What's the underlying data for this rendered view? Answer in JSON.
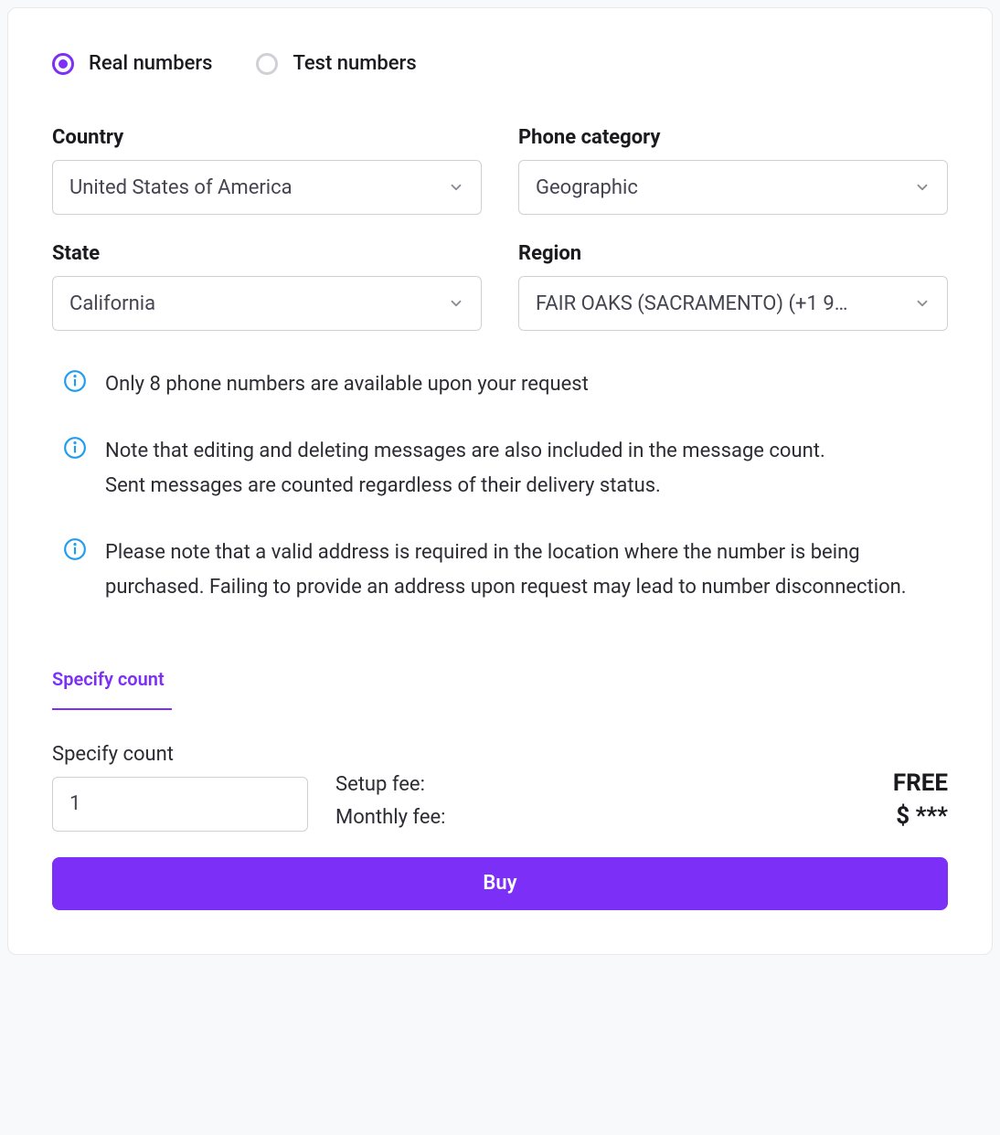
{
  "radios": {
    "real": {
      "label": "Real numbers",
      "selected": true
    },
    "test": {
      "label": "Test numbers",
      "selected": false
    }
  },
  "fields": {
    "country": {
      "label": "Country",
      "value": "United States of America"
    },
    "category": {
      "label": "Phone category",
      "value": "Geographic"
    },
    "state": {
      "label": "State",
      "value": "California"
    },
    "region": {
      "label": "Region",
      "value": "FAIR OAKS (SACRAMENTO) (+1 9…"
    }
  },
  "notes": {
    "availability": "Only 8 phone numbers are available upon your request",
    "messages_line1": "Note that editing and deleting messages are also included in the message count.",
    "messages_line2": "Sent messages are counted regardless of their delivery status.",
    "address": "Please note that a valid address is required in the location where the number is being purchased. Failing to provide an address upon request may lead to number disconnection."
  },
  "tabs": {
    "specify_count": "Specify count"
  },
  "count": {
    "label": "Specify count",
    "value": "1"
  },
  "fees": {
    "setup_label": "Setup fee:",
    "setup_value": "FREE",
    "monthly_label": "Monthly fee:",
    "monthly_value": "$ ***"
  },
  "buy_label": "Buy"
}
